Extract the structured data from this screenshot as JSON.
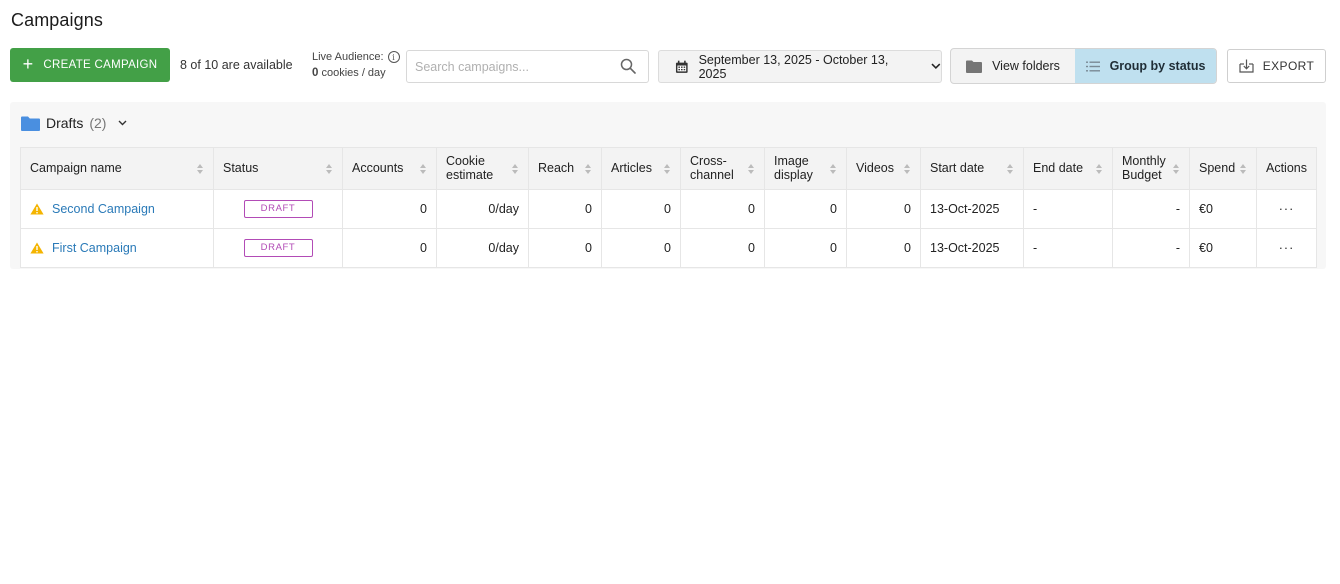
{
  "page": {
    "title": "Campaigns"
  },
  "toolbar": {
    "create_label": "CREATE CAMPAIGN",
    "available_text": "8 of 10 are available",
    "live_audience_label": "Live Audience:",
    "live_audience_value": "0",
    "live_audience_unit": "cookies / day",
    "search_placeholder": "Search campaigns...",
    "date_range": "September 13, 2025 - October 13, 2025",
    "view_folders_label": "View folders",
    "group_by_status_label": "Group by status",
    "export_label": "EXPORT"
  },
  "group": {
    "name": "Drafts",
    "count": "(2)"
  },
  "table": {
    "columns": [
      {
        "line1": "Campaign name",
        "line2": ""
      },
      {
        "line1": "Status",
        "line2": ""
      },
      {
        "line1": "Accounts",
        "line2": ""
      },
      {
        "line1": "Cookie",
        "line2": "estimate"
      },
      {
        "line1": "Reach",
        "line2": ""
      },
      {
        "line1": "Articles",
        "line2": ""
      },
      {
        "line1": "Cross-",
        "line2": "channel"
      },
      {
        "line1": "Image",
        "line2": "display"
      },
      {
        "line1": "Videos",
        "line2": ""
      },
      {
        "line1": "Start date",
        "line2": ""
      },
      {
        "line1": "End date",
        "line2": ""
      },
      {
        "line1": "Monthly",
        "line2": "Budget"
      },
      {
        "line1": "Spend",
        "line2": ""
      },
      {
        "line1": "Actions",
        "line2": ""
      }
    ],
    "rows": [
      {
        "name": "Second Campaign",
        "status": "DRAFT",
        "accounts": "0",
        "cookie": "0/day",
        "reach": "0",
        "articles": "0",
        "cross": "0",
        "image": "0",
        "videos": "0",
        "start": "13-Oct-2025",
        "end": "-",
        "budget": "-",
        "spend": "€0",
        "actions": "···"
      },
      {
        "name": "First Campaign",
        "status": "DRAFT",
        "accounts": "0",
        "cookie": "0/day",
        "reach": "0",
        "articles": "0",
        "cross": "0",
        "image": "0",
        "videos": "0",
        "start": "13-Oct-2025",
        "end": "-",
        "budget": "-",
        "spend": "€0",
        "actions": "···"
      }
    ]
  },
  "colors": {
    "primary_green": "#43a047",
    "link_blue": "#2a7ab8",
    "draft_purple": "#b24bb6",
    "active_toggle": "#bfe0ef",
    "warning_yellow": "#f4b400",
    "folder_blue": "#4a8fe0"
  },
  "icons": {
    "create": "plus-icon",
    "info": "info-icon",
    "search": "search-icon",
    "date": "calendar-icon",
    "folders": "folder-icon",
    "status": "list-icon",
    "export": "download-icon",
    "warning": "warning-icon",
    "sort": "sort-icon",
    "actions": "more-horizontal-icon"
  }
}
